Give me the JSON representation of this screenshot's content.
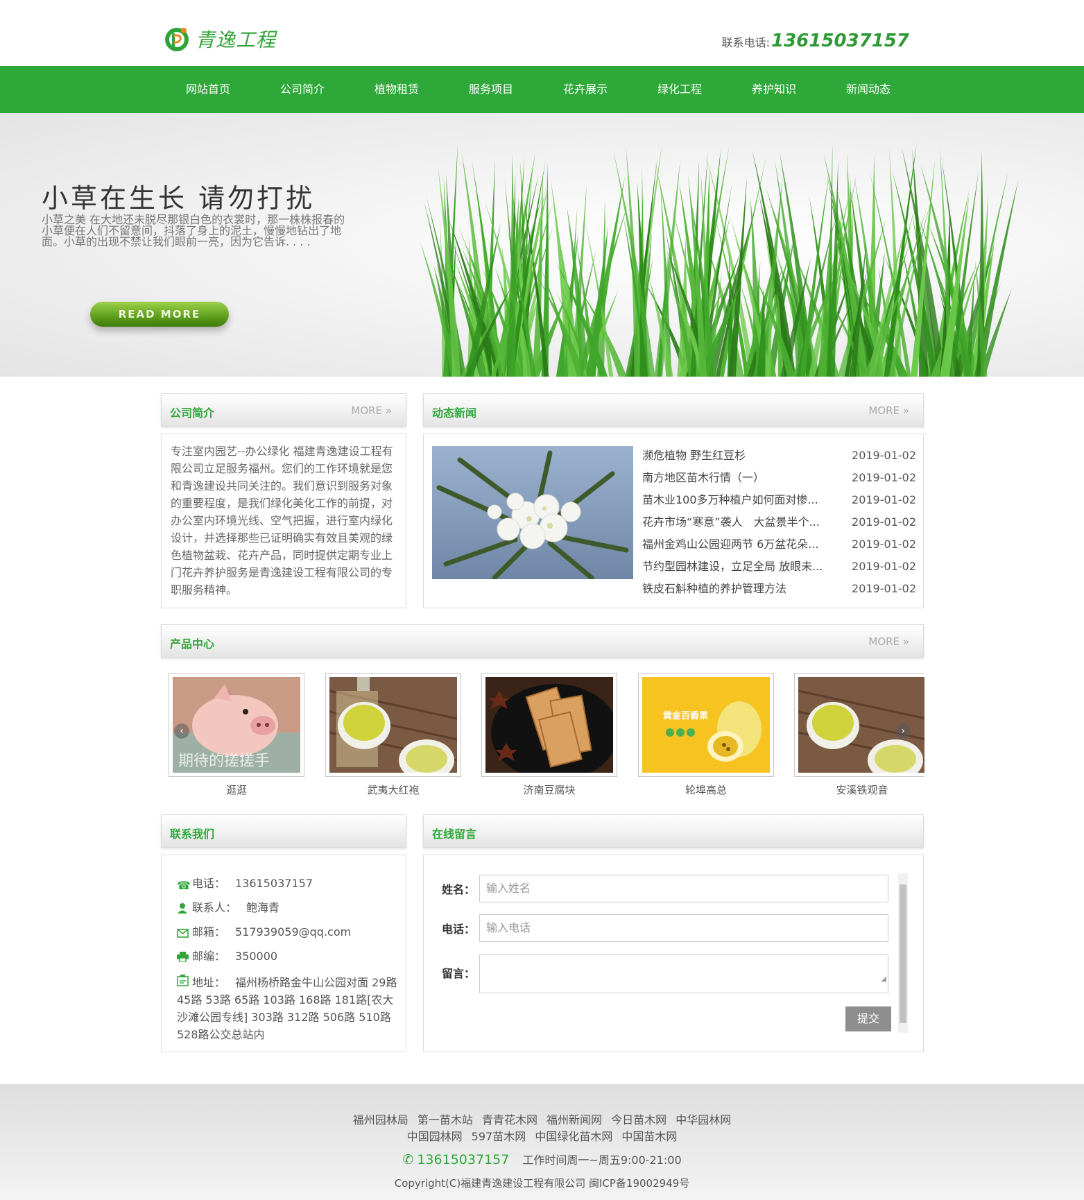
{
  "header": {
    "logo_text": "青逸工程",
    "phone_label": "联系电话:",
    "phone_number": "13615037157"
  },
  "nav": {
    "items": [
      "网站首页",
      "公司简介",
      "植物租赁",
      "服务项目",
      "花卉展示",
      "绿化工程",
      "养护知识",
      "新闻动态"
    ]
  },
  "banner": {
    "title": "小草在生长  请勿打扰",
    "text": "小草之美 在大地还未脱尽那银白色的衣裳时，那一株株报春的小草便在人们不留意间，抖落了身上的泥土，慢慢地钻出了地面。小草的出现不禁让我们眼前一亮，因为它告诉. . . .",
    "button": "READ MORE"
  },
  "about": {
    "title": "公司简介",
    "more": "MORE",
    "text": "专注室内园艺--办公绿化 福建青逸建设工程有限公司立足服务福州。您们的工作环境就是您和青逸建设共同关注的。我们意识到服务对象的重要程度，是我们绿化美化工作的前提，对办公室内环境光线、空气把握，进行室内绿化设计，并选择那些已证明确实有效且美观的绿色植物盆栽、花卉产品，同时提供定期专业上门花卉养护服务是青逸建设工程有限公司的专职服务精神。"
  },
  "news": {
    "title": "动态新闻",
    "more": "MORE",
    "items": [
      {
        "title": "濒危植物 野生红豆杉",
        "date": "2019-01-02"
      },
      {
        "title": "南方地区苗木行情（一）",
        "date": "2019-01-02"
      },
      {
        "title": "苗木业100多万种植户如何面对惨...",
        "date": "2019-01-02"
      },
      {
        "title": "花卉市场“寒意”袭人　大盆景半个...",
        "date": "2019-01-02"
      },
      {
        "title": "福州金鸡山公园迎两节 6万盆花朵...",
        "date": "2019-01-02"
      },
      {
        "title": "节约型园林建设，立足全局 放眼未...",
        "date": "2019-01-02"
      },
      {
        "title": "铁皮石斛种植的养护管理方法",
        "date": "2019-01-02"
      }
    ]
  },
  "products": {
    "title": "产品中心",
    "more": "MORE",
    "items": [
      {
        "caption": "逛逛",
        "overlay": "期待的搓搓手"
      },
      {
        "caption": "武夷大红袍",
        "overlay": ""
      },
      {
        "caption": "济南豆腐块",
        "overlay": ""
      },
      {
        "caption": "轮埠高总",
        "overlay": "黄金百香果"
      },
      {
        "caption": "安溪铁观音",
        "overlay": ""
      }
    ]
  },
  "contact": {
    "title": "联系我们",
    "items": [
      {
        "icon": "phone-icon",
        "label": "电话：",
        "value": "13615037157"
      },
      {
        "icon": "person-icon",
        "label": "联系人：",
        "value": "鲍海青"
      },
      {
        "icon": "mail-icon",
        "label": "邮箱：",
        "value": "517939059@qq.com"
      },
      {
        "icon": "printer-icon",
        "label": "邮编：",
        "value": "350000"
      },
      {
        "icon": "address-icon",
        "label": "地址：",
        "value": "福州杨桥路金牛山公园对面 29路 45路 53路 65路 103路 168路 181路[农大沙滩公园专线] 303路 312路 506路 510路 528路公交总站内"
      }
    ]
  },
  "message": {
    "title": "在线留言",
    "name_label": "姓名：",
    "name_placeholder": "输入姓名",
    "phone_label": "电话：",
    "phone_placeholder": "输入电话",
    "msg_label": "留言：",
    "submit": "提交"
  },
  "footer": {
    "links_row1": [
      "福州园林局",
      "第一苗木站",
      "青青花木网",
      "福州新闻网",
      "今日苗木网",
      "中华园林网"
    ],
    "links_row2": [
      "中国园林网",
      "597苗木网",
      "中国绿化苗木网",
      "中国苗木网"
    ],
    "phone": "13615037157",
    "hours": "工作时间周一~周五9:00-21:00",
    "copyright": "Copyright(C)福建青逸建设工程有限公司 闽ICP备19002949号"
  },
  "colors": {
    "brand_green": "#2ea838",
    "button_gray": "#8e8e8e"
  }
}
